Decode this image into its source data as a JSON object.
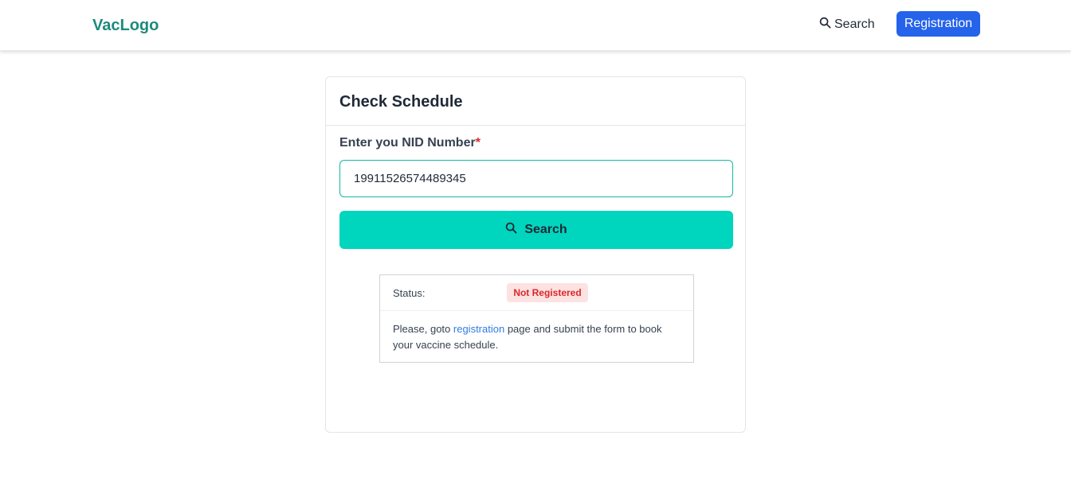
{
  "navbar": {
    "logo": "VacLogo",
    "search_label": "Search",
    "registration_label": "Registration"
  },
  "card": {
    "title": "Check Schedule",
    "field_label": "Enter you NID Number",
    "required_mark": "*",
    "nid_value": "19911526574489345",
    "search_button_label": "Search"
  },
  "status": {
    "label": "Status:",
    "badge": "Not Registered",
    "message_before": "Please, goto ",
    "link_text": "registration",
    "message_after": " page and submit the form to book your vaccine schedule."
  },
  "colors": {
    "brand": "#1d8a7d",
    "primary": "#2563eb",
    "accent": "#00d5be",
    "danger": "#dc2626"
  }
}
